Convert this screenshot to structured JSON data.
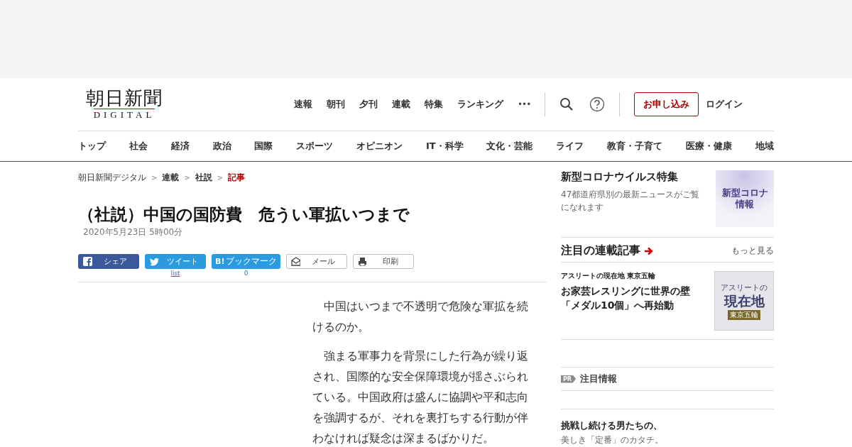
{
  "logo": {
    "title": "朝日新聞",
    "subtitle": "DIGITAL"
  },
  "header_nav": [
    "速報",
    "朝刊",
    "夕刊",
    "連載",
    "特集",
    "ランキング"
  ],
  "more_icon": "•••",
  "apply_button": "お申し込み",
  "login": "ログイン",
  "categories": [
    "トップ",
    "社会",
    "経済",
    "政治",
    "国際",
    "スポーツ",
    "オピニオン",
    "IT・科学",
    "文化・芸能",
    "ライフ",
    "教育・子育て",
    "医療・健康",
    "地域"
  ],
  "breadcrumb_separator": ">",
  "breadcrumb": [
    {
      "label": "朝日新聞デジタル",
      "kind": "home",
      "current": false
    },
    {
      "label": "連載",
      "kind": "section",
      "current": false
    },
    {
      "label": "社説",
      "kind": "section",
      "current": false
    },
    {
      "label": "記事",
      "kind": "section",
      "current": true
    }
  ],
  "article": {
    "title": "（社説）中国の国防費　危うい軍拡いつまで",
    "date": "2020年5月23日 5時00分",
    "share_buttons": [
      {
        "kind": "facebook",
        "label": "シェア"
      },
      {
        "kind": "twitter",
        "label": "ツイート",
        "count": "list"
      },
      {
        "kind": "hatena",
        "icon_text": "B!",
        "label": "ブックマーク",
        "count": "0"
      },
      {
        "kind": "mail",
        "label": "メール"
      },
      {
        "kind": "print",
        "label": "印刷"
      }
    ],
    "paragraphs": [
      "　中国はいつまで不透明で危険な軍拡を続けるのか。",
      "　強まる軍事力を背景にした行為が繰り返され、国際的な安全保障環境が揺さぶられている。中国政府は盛んに協調や平和志向を強調するが、それを裏打ちする行動が伴わなければ疑念は深まるばかりだ。"
    ]
  },
  "sidebar": {
    "feature": {
      "title": "新型コロナウイルス特集",
      "text": "47都道府県別の最新ニュースがご覧になれます",
      "banner": [
        "新型コロナ",
        "情報"
      ]
    },
    "series": {
      "heading": "注目の連載記事",
      "more": "もっと見る",
      "items": [
        {
          "label": "アスリートの現在地 東京五輪",
          "title": "お家芸レスリングに世界の壁「メダル10個」へ再始動",
          "banner_top": "アスリートの",
          "banner_main": "現在地",
          "banner_tag": "東京五輪"
        }
      ]
    },
    "pr": {
      "badge": "PR",
      "heading": "注目情報",
      "items": [
        {
          "title": "挑戦し続ける男たちの、",
          "text": "美しき「定番」のカタチ。"
        }
      ]
    }
  }
}
